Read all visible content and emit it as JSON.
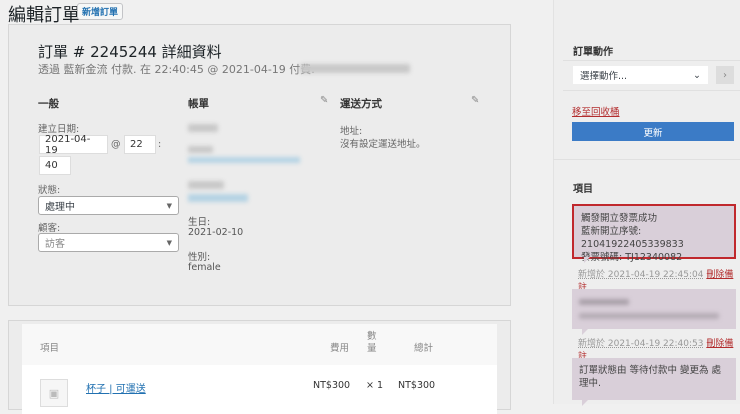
{
  "header": {
    "title": "編輯訂單",
    "new_order": "新增訂單"
  },
  "order": {
    "heading": "訂單 # 2245244 詳細資料",
    "subtitle": "透過 藍新金流 付款. 在 22:40:45 @ 2021-04-19 付費."
  },
  "general": {
    "title": "一般",
    "created_label": "建立日期:",
    "date": "2021-04-19",
    "at": "@",
    "hour": "22",
    "colon": ":",
    "minute": "40",
    "status_label": "狀態:",
    "status": "處理中",
    "customer_label": "顧客:",
    "customer": "訪客"
  },
  "billing": {
    "title": "帳單",
    "birthday_label": "生日:",
    "birthday": "2021-02-10",
    "gender_label": "性別:",
    "gender": "female"
  },
  "shipping": {
    "title": "運送方式",
    "address_label": "地址:",
    "address": "沒有設定運送地址。"
  },
  "items": {
    "headers": {
      "item": "項目",
      "cost": "費用",
      "qty": "數量",
      "total": "總計"
    },
    "rows": [
      {
        "name": "杯子 | 可運送",
        "cost": "NT$300",
        "qty": "× 1",
        "total": "NT$300"
      }
    ]
  },
  "actions": {
    "title": "訂單動作",
    "select": "選擇動作...",
    "go": "›",
    "trash": "移至回收桶",
    "update": "更新"
  },
  "notes": {
    "title": "項目",
    "list": [
      {
        "lines": [
          "觸發開立發票成功",
          "藍新開立序號: 21041922405339833",
          "發票號碼: TJ12340082"
        ],
        "meta": "新增於 2021-04-19 22:45:04",
        "delete": "刪除備註"
      },
      {
        "meta": "新增於 2021-04-19 22:40:53",
        "delete": "刪除備註"
      },
      {
        "lines": [
          "訂單狀態由 等待付款中 變更為 處理中."
        ]
      }
    ]
  },
  "colors": {
    "accent": "#3b7bc6",
    "danger": "#b32d2e",
    "highlight": "#c0282d"
  }
}
